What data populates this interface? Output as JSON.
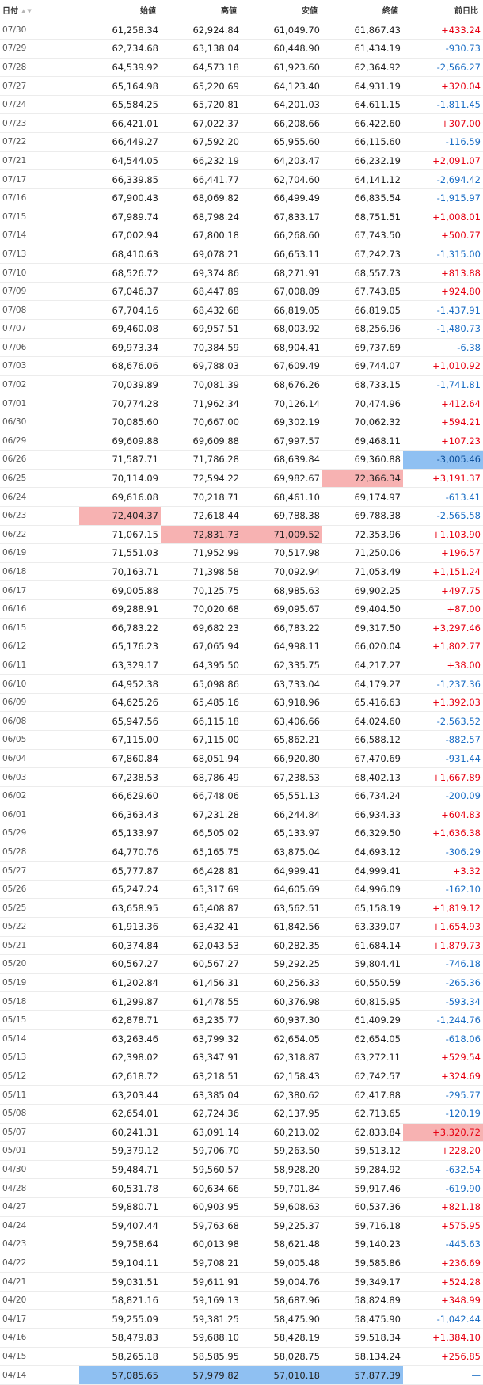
{
  "table": {
    "headers": {
      "date": "日付",
      "open": "始値",
      "high": "高値",
      "low": "安値",
      "close": "終値",
      "change": "前日比"
    },
    "colors": {
      "up": "#e60012",
      "down": "#1a6dc4",
      "highlight_red": "#f7b2b2",
      "highlight_blue": "#8fc0f2"
    },
    "rows": [
      {
        "date": "07/30",
        "open": "61,258.34",
        "high": "62,924.84",
        "low": "61,049.70",
        "close": "61,867.43",
        "change": "+433.24"
      },
      {
        "date": "07/29",
        "open": "62,734.68",
        "high": "63,138.04",
        "low": "60,448.90",
        "close": "61,434.19",
        "change": "-930.73"
      },
      {
        "date": "07/28",
        "open": "64,539.92",
        "high": "64,573.18",
        "low": "61,923.60",
        "close": "62,364.92",
        "change": "-2,566.27"
      },
      {
        "date": "07/27",
        "open": "65,164.98",
        "high": "65,220.69",
        "low": "64,123.40",
        "close": "64,931.19",
        "change": "+320.04"
      },
      {
        "date": "07/24",
        "open": "65,584.25",
        "high": "65,720.81",
        "low": "64,201.03",
        "close": "64,611.15",
        "change": "-1,811.45"
      },
      {
        "date": "07/23",
        "open": "66,421.01",
        "high": "67,022.37",
        "low": "66,208.66",
        "close": "66,422.60",
        "change": "+307.00"
      },
      {
        "date": "07/22",
        "open": "66,449.27",
        "high": "67,592.20",
        "low": "65,955.60",
        "close": "66,115.60",
        "change": "-116.59"
      },
      {
        "date": "07/21",
        "open": "64,544.05",
        "high": "66,232.19",
        "low": "64,203.47",
        "close": "66,232.19",
        "change": "+2,091.07"
      },
      {
        "date": "07/17",
        "open": "66,339.85",
        "high": "66,441.77",
        "low": "62,704.60",
        "close": "64,141.12",
        "change": "-2,694.42"
      },
      {
        "date": "07/16",
        "open": "67,900.43",
        "high": "68,069.82",
        "low": "66,499.49",
        "close": "66,835.54",
        "change": "-1,915.97"
      },
      {
        "date": "07/15",
        "open": "67,989.74",
        "high": "68,798.24",
        "low": "67,833.17",
        "close": "68,751.51",
        "change": "+1,008.01"
      },
      {
        "date": "07/14",
        "open": "67,002.94",
        "high": "67,800.18",
        "low": "66,268.60",
        "close": "67,743.50",
        "change": "+500.77"
      },
      {
        "date": "07/13",
        "open": "68,410.63",
        "high": "69,078.21",
        "low": "66,653.11",
        "close": "67,242.73",
        "change": "-1,315.00"
      },
      {
        "date": "07/10",
        "open": "68,526.72",
        "high": "69,374.86",
        "low": "68,271.91",
        "close": "68,557.73",
        "change": "+813.88"
      },
      {
        "date": "07/09",
        "open": "67,046.37",
        "high": "68,447.89",
        "low": "67,008.89",
        "close": "67,743.85",
        "change": "+924.80"
      },
      {
        "date": "07/08",
        "open": "67,704.16",
        "high": "68,432.68",
        "low": "66,819.05",
        "close": "66,819.05",
        "change": "-1,437.91"
      },
      {
        "date": "07/07",
        "open": "69,460.08",
        "high": "69,957.51",
        "low": "68,003.92",
        "close": "68,256.96",
        "change": "-1,480.73"
      },
      {
        "date": "07/06",
        "open": "69,973.34",
        "high": "70,384.59",
        "low": "68,904.41",
        "close": "69,737.69",
        "change": "-6.38"
      },
      {
        "date": "07/03",
        "open": "68,676.06",
        "high": "69,788.03",
        "low": "67,609.49",
        "close": "69,744.07",
        "change": "+1,010.92"
      },
      {
        "date": "07/02",
        "open": "70,039.89",
        "high": "70,081.39",
        "low": "68,676.26",
        "close": "68,733.15",
        "change": "-1,741.81"
      },
      {
        "date": "07/01",
        "open": "70,774.28",
        "high": "71,962.34",
        "low": "70,126.14",
        "close": "70,474.96",
        "change": "+412.64"
      },
      {
        "date": "06/30",
        "open": "70,085.60",
        "high": "70,667.00",
        "low": "69,302.19",
        "close": "70,062.32",
        "change": "+594.21"
      },
      {
        "date": "06/29",
        "open": "69,609.88",
        "high": "69,609.88",
        "low": "67,997.57",
        "close": "69,468.11",
        "change": "+107.23"
      },
      {
        "date": "06/26",
        "open": "71,587.71",
        "high": "71,786.28",
        "low": "68,639.84",
        "close": "69,360.88",
        "change": "-3,005.46",
        "hl": {
          "change": "blue"
        }
      },
      {
        "date": "06/25",
        "open": "70,114.09",
        "high": "72,594.22",
        "low": "69,982.67",
        "close": "72,366.34",
        "change": "+3,191.37",
        "hl": {
          "close": "red"
        }
      },
      {
        "date": "06/24",
        "open": "69,616.08",
        "high": "70,218.71",
        "low": "68,461.10",
        "close": "69,174.97",
        "change": "-613.41"
      },
      {
        "date": "06/23",
        "open": "72,404.37",
        "high": "72,618.44",
        "low": "69,788.38",
        "close": "69,788.38",
        "change": "-2,565.58",
        "hl": {
          "open": "red"
        }
      },
      {
        "date": "06/22",
        "open": "71,067.15",
        "high": "72,831.73",
        "low": "71,009.52",
        "close": "72,353.96",
        "change": "+1,103.90",
        "hl": {
          "high": "red",
          "low": "red"
        }
      },
      {
        "date": "06/19",
        "open": "71,551.03",
        "high": "71,952.99",
        "low": "70,517.98",
        "close": "71,250.06",
        "change": "+196.57"
      },
      {
        "date": "06/18",
        "open": "70,163.71",
        "high": "71,398.58",
        "low": "70,092.94",
        "close": "71,053.49",
        "change": "+1,151.24"
      },
      {
        "date": "06/17",
        "open": "69,005.88",
        "high": "70,125.75",
        "low": "68,985.63",
        "close": "69,902.25",
        "change": "+497.75"
      },
      {
        "date": "06/16",
        "open": "69,288.91",
        "high": "70,020.68",
        "low": "69,095.67",
        "close": "69,404.50",
        "change": "+87.00"
      },
      {
        "date": "06/15",
        "open": "66,783.22",
        "high": "69,682.23",
        "low": "66,783.22",
        "close": "69,317.50",
        "change": "+3,297.46"
      },
      {
        "date": "06/12",
        "open": "65,176.23",
        "high": "67,065.94",
        "low": "64,998.11",
        "close": "66,020.04",
        "change": "+1,802.77"
      },
      {
        "date": "06/11",
        "open": "63,329.17",
        "high": "64,395.50",
        "low": "62,335.75",
        "close": "64,217.27",
        "change": "+38.00"
      },
      {
        "date": "06/10",
        "open": "64,952.38",
        "high": "65,098.86",
        "low": "63,733.04",
        "close": "64,179.27",
        "change": "-1,237.36"
      },
      {
        "date": "06/09",
        "open": "64,625.26",
        "high": "65,485.16",
        "low": "63,918.96",
        "close": "65,416.63",
        "change": "+1,392.03"
      },
      {
        "date": "06/08",
        "open": "65,947.56",
        "high": "66,115.18",
        "low": "63,406.66",
        "close": "64,024.60",
        "change": "-2,563.52"
      },
      {
        "date": "06/05",
        "open": "67,115.00",
        "high": "67,115.00",
        "low": "65,862.21",
        "close": "66,588.12",
        "change": "-882.57"
      },
      {
        "date": "06/04",
        "open": "67,860.84",
        "high": "68,051.94",
        "low": "66,920.80",
        "close": "67,470.69",
        "change": "-931.44"
      },
      {
        "date": "06/03",
        "open": "67,238.53",
        "high": "68,786.49",
        "low": "67,238.53",
        "close": "68,402.13",
        "change": "+1,667.89"
      },
      {
        "date": "06/02",
        "open": "66,629.60",
        "high": "66,748.06",
        "low": "65,551.13",
        "close": "66,734.24",
        "change": "-200.09"
      },
      {
        "date": "06/01",
        "open": "66,363.43",
        "high": "67,231.28",
        "low": "66,244.84",
        "close": "66,934.33",
        "change": "+604.83"
      },
      {
        "date": "05/29",
        "open": "65,133.97",
        "high": "66,505.02",
        "low": "65,133.97",
        "close": "66,329.50",
        "change": "+1,636.38"
      },
      {
        "date": "05/28",
        "open": "64,770.76",
        "high": "65,165.75",
        "low": "63,875.04",
        "close": "64,693.12",
        "change": "-306.29"
      },
      {
        "date": "05/27",
        "open": "65,777.87",
        "high": "66,428.81",
        "low": "64,999.41",
        "close": "64,999.41",
        "change": "+3.32"
      },
      {
        "date": "05/26",
        "open": "65,247.24",
        "high": "65,317.69",
        "low": "64,605.69",
        "close": "64,996.09",
        "change": "-162.10"
      },
      {
        "date": "05/25",
        "open": "63,658.95",
        "high": "65,408.87",
        "low": "63,562.51",
        "close": "65,158.19",
        "change": "+1,819.12"
      },
      {
        "date": "05/22",
        "open": "61,913.36",
        "high": "63,432.41",
        "low": "61,842.56",
        "close": "63,339.07",
        "change": "+1,654.93"
      },
      {
        "date": "05/21",
        "open": "60,374.84",
        "high": "62,043.53",
        "low": "60,282.35",
        "close": "61,684.14",
        "change": "+1,879.73"
      },
      {
        "date": "05/20",
        "open": "60,567.27",
        "high": "60,567.27",
        "low": "59,292.25",
        "close": "59,804.41",
        "change": "-746.18"
      },
      {
        "date": "05/19",
        "open": "61,202.84",
        "high": "61,456.31",
        "low": "60,256.33",
        "close": "60,550.59",
        "change": "-265.36"
      },
      {
        "date": "05/18",
        "open": "61,299.87",
        "high": "61,478.55",
        "low": "60,376.98",
        "close": "60,815.95",
        "change": "-593.34"
      },
      {
        "date": "05/15",
        "open": "62,878.71",
        "high": "63,235.77",
        "low": "60,937.30",
        "close": "61,409.29",
        "change": "-1,244.76"
      },
      {
        "date": "05/14",
        "open": "63,263.46",
        "high": "63,799.32",
        "low": "62,654.05",
        "close": "62,654.05",
        "change": "-618.06"
      },
      {
        "date": "05/13",
        "open": "62,398.02",
        "high": "63,347.91",
        "low": "62,318.87",
        "close": "63,272.11",
        "change": "+529.54"
      },
      {
        "date": "05/12",
        "open": "62,618.72",
        "high": "63,218.51",
        "low": "62,158.43",
        "close": "62,742.57",
        "change": "+324.69"
      },
      {
        "date": "05/11",
        "open": "63,203.44",
        "high": "63,385.04",
        "low": "62,380.62",
        "close": "62,417.88",
        "change": "-295.77"
      },
      {
        "date": "05/08",
        "open": "62,654.01",
        "high": "62,724.36",
        "low": "62,137.95",
        "close": "62,713.65",
        "change": "-120.19"
      },
      {
        "date": "05/07",
        "open": "60,241.31",
        "high": "63,091.14",
        "low": "60,213.02",
        "close": "62,833.84",
        "change": "+3,320.72",
        "hl": {
          "change": "red"
        }
      },
      {
        "date": "05/01",
        "open": "59,379.12",
        "high": "59,706.70",
        "low": "59,263.50",
        "close": "59,513.12",
        "change": "+228.20"
      },
      {
        "date": "04/30",
        "open": "59,484.71",
        "high": "59,560.57",
        "low": "58,928.20",
        "close": "59,284.92",
        "change": "-632.54"
      },
      {
        "date": "04/28",
        "open": "60,531.78",
        "high": "60,634.66",
        "low": "59,701.84",
        "close": "59,917.46",
        "change": "-619.90"
      },
      {
        "date": "04/27",
        "open": "59,880.71",
        "high": "60,903.95",
        "low": "59,608.63",
        "close": "60,537.36",
        "change": "+821.18"
      },
      {
        "date": "04/24",
        "open": "59,407.44",
        "high": "59,763.68",
        "low": "59,225.37",
        "close": "59,716.18",
        "change": "+575.95"
      },
      {
        "date": "04/23",
        "open": "59,758.64",
        "high": "60,013.98",
        "low": "58,621.48",
        "close": "59,140.23",
        "change": "-445.63"
      },
      {
        "date": "04/22",
        "open": "59,104.11",
        "high": "59,708.21",
        "low": "59,005.48",
        "close": "59,585.86",
        "change": "+236.69"
      },
      {
        "date": "04/21",
        "open": "59,031.51",
        "high": "59,611.91",
        "low": "59,004.76",
        "close": "59,349.17",
        "change": "+524.28"
      },
      {
        "date": "04/20",
        "open": "58,821.16",
        "high": "59,169.13",
        "low": "58,687.96",
        "close": "58,824.89",
        "change": "+348.99"
      },
      {
        "date": "04/17",
        "open": "59,255.09",
        "high": "59,381.25",
        "low": "58,475.90",
        "close": "58,475.90",
        "change": "-1,042.44"
      },
      {
        "date": "04/16",
        "open": "58,479.83",
        "high": "59,688.10",
        "low": "58,428.19",
        "close": "59,518.34",
        "change": "+1,384.10"
      },
      {
        "date": "04/15",
        "open": "58,265.18",
        "high": "58,585.95",
        "low": "58,028.75",
        "close": "58,134.24",
        "change": "+256.85"
      },
      {
        "date": "04/14",
        "open": "57,085.65",
        "high": "57,979.82",
        "low": "57,010.18",
        "close": "57,877.39",
        "change": "—",
        "hl": {
          "open": "blue",
          "high": "blue",
          "low": "blue",
          "close": "blue"
        }
      }
    ]
  }
}
